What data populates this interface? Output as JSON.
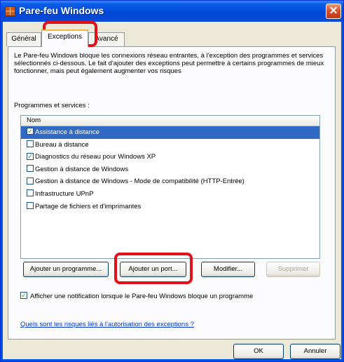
{
  "window": {
    "title": "Pare-feu Windows",
    "close_symbol": "✕"
  },
  "tabs": [
    {
      "label": "Général"
    },
    {
      "label": "Exceptions"
    },
    {
      "label": "Avancé"
    }
  ],
  "description": "Le Pare-feu Windows bloque les connexions réseau entrantes, à l'exception des programmes et services sélectionnés ci-dessous. Le fait d'ajouter des exceptions peut permettre à certains programmes de mieux fonctionner, mais peut également augmenter vos risques",
  "section_label": "Programmes et services :",
  "list": {
    "header": "Nom",
    "items": [
      {
        "label": "Assistance à distance",
        "checked": true,
        "selected": true
      },
      {
        "label": "Bureau à distance",
        "checked": false,
        "selected": false
      },
      {
        "label": "Diagnostics du réseau pour Windows XP",
        "checked": true,
        "selected": false
      },
      {
        "label": "Gestion à distance de Windows",
        "checked": false,
        "selected": false
      },
      {
        "label": "Gestion à distance de Windows - Mode de compatibilité (HTTP-Entrée)",
        "checked": false,
        "selected": false
      },
      {
        "label": "Infrastructure UPnP",
        "checked": false,
        "selected": false
      },
      {
        "label": "Partage de fichiers et d'imprimantes",
        "checked": false,
        "selected": false
      }
    ]
  },
  "buttons": {
    "add_program": "Ajouter un programme...",
    "add_port": "Ajouter un port...",
    "modify": "Modifier...",
    "delete": "Supprimer"
  },
  "notify": {
    "label": "Afficher une notification lorsque le Pare-feu Windows bloque un programme",
    "checked": true
  },
  "risk_link": "Quels sont les risques liés à l'autorisation des exceptions ?",
  "footer": {
    "ok": "OK",
    "cancel": "Annuler"
  },
  "checkmark": "✓",
  "colors": {
    "title_bar": "#0054e3",
    "selection": "#316ac5",
    "highlight": "#e3101a",
    "link": "#0033cc"
  }
}
